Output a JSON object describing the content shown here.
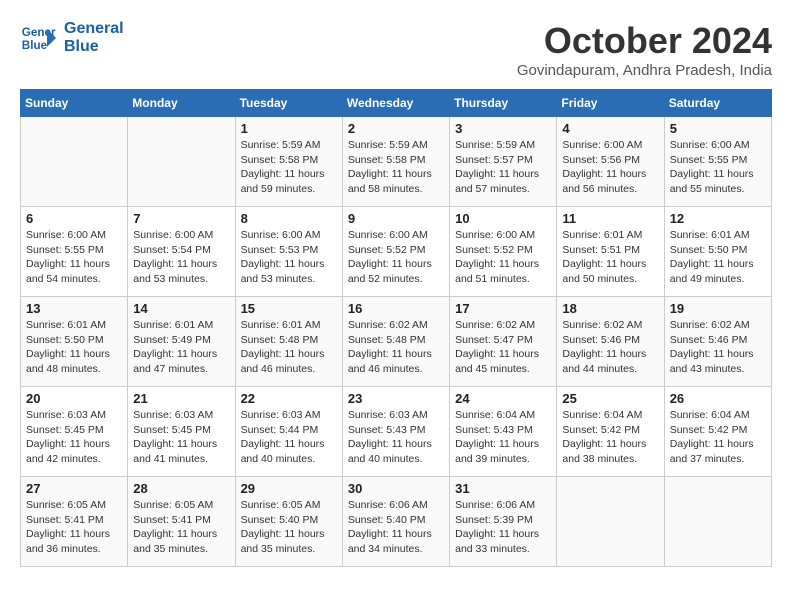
{
  "header": {
    "logo_line1": "General",
    "logo_line2": "Blue",
    "month": "October 2024",
    "location": "Govindapuram, Andhra Pradesh, India"
  },
  "days_of_week": [
    "Sunday",
    "Monday",
    "Tuesday",
    "Wednesday",
    "Thursday",
    "Friday",
    "Saturday"
  ],
  "weeks": [
    [
      {
        "day": "",
        "info": ""
      },
      {
        "day": "",
        "info": ""
      },
      {
        "day": "1",
        "info": "Sunrise: 5:59 AM\nSunset: 5:58 PM\nDaylight: 11 hours and 59 minutes."
      },
      {
        "day": "2",
        "info": "Sunrise: 5:59 AM\nSunset: 5:58 PM\nDaylight: 11 hours and 58 minutes."
      },
      {
        "day": "3",
        "info": "Sunrise: 5:59 AM\nSunset: 5:57 PM\nDaylight: 11 hours and 57 minutes."
      },
      {
        "day": "4",
        "info": "Sunrise: 6:00 AM\nSunset: 5:56 PM\nDaylight: 11 hours and 56 minutes."
      },
      {
        "day": "5",
        "info": "Sunrise: 6:00 AM\nSunset: 5:55 PM\nDaylight: 11 hours and 55 minutes."
      }
    ],
    [
      {
        "day": "6",
        "info": "Sunrise: 6:00 AM\nSunset: 5:55 PM\nDaylight: 11 hours and 54 minutes."
      },
      {
        "day": "7",
        "info": "Sunrise: 6:00 AM\nSunset: 5:54 PM\nDaylight: 11 hours and 53 minutes."
      },
      {
        "day": "8",
        "info": "Sunrise: 6:00 AM\nSunset: 5:53 PM\nDaylight: 11 hours and 53 minutes."
      },
      {
        "day": "9",
        "info": "Sunrise: 6:00 AM\nSunset: 5:52 PM\nDaylight: 11 hours and 52 minutes."
      },
      {
        "day": "10",
        "info": "Sunrise: 6:00 AM\nSunset: 5:52 PM\nDaylight: 11 hours and 51 minutes."
      },
      {
        "day": "11",
        "info": "Sunrise: 6:01 AM\nSunset: 5:51 PM\nDaylight: 11 hours and 50 minutes."
      },
      {
        "day": "12",
        "info": "Sunrise: 6:01 AM\nSunset: 5:50 PM\nDaylight: 11 hours and 49 minutes."
      }
    ],
    [
      {
        "day": "13",
        "info": "Sunrise: 6:01 AM\nSunset: 5:50 PM\nDaylight: 11 hours and 48 minutes."
      },
      {
        "day": "14",
        "info": "Sunrise: 6:01 AM\nSunset: 5:49 PM\nDaylight: 11 hours and 47 minutes."
      },
      {
        "day": "15",
        "info": "Sunrise: 6:01 AM\nSunset: 5:48 PM\nDaylight: 11 hours and 46 minutes."
      },
      {
        "day": "16",
        "info": "Sunrise: 6:02 AM\nSunset: 5:48 PM\nDaylight: 11 hours and 46 minutes."
      },
      {
        "day": "17",
        "info": "Sunrise: 6:02 AM\nSunset: 5:47 PM\nDaylight: 11 hours and 45 minutes."
      },
      {
        "day": "18",
        "info": "Sunrise: 6:02 AM\nSunset: 5:46 PM\nDaylight: 11 hours and 44 minutes."
      },
      {
        "day": "19",
        "info": "Sunrise: 6:02 AM\nSunset: 5:46 PM\nDaylight: 11 hours and 43 minutes."
      }
    ],
    [
      {
        "day": "20",
        "info": "Sunrise: 6:03 AM\nSunset: 5:45 PM\nDaylight: 11 hours and 42 minutes."
      },
      {
        "day": "21",
        "info": "Sunrise: 6:03 AM\nSunset: 5:45 PM\nDaylight: 11 hours and 41 minutes."
      },
      {
        "day": "22",
        "info": "Sunrise: 6:03 AM\nSunset: 5:44 PM\nDaylight: 11 hours and 40 minutes."
      },
      {
        "day": "23",
        "info": "Sunrise: 6:03 AM\nSunset: 5:43 PM\nDaylight: 11 hours and 40 minutes."
      },
      {
        "day": "24",
        "info": "Sunrise: 6:04 AM\nSunset: 5:43 PM\nDaylight: 11 hours and 39 minutes."
      },
      {
        "day": "25",
        "info": "Sunrise: 6:04 AM\nSunset: 5:42 PM\nDaylight: 11 hours and 38 minutes."
      },
      {
        "day": "26",
        "info": "Sunrise: 6:04 AM\nSunset: 5:42 PM\nDaylight: 11 hours and 37 minutes."
      }
    ],
    [
      {
        "day": "27",
        "info": "Sunrise: 6:05 AM\nSunset: 5:41 PM\nDaylight: 11 hours and 36 minutes."
      },
      {
        "day": "28",
        "info": "Sunrise: 6:05 AM\nSunset: 5:41 PM\nDaylight: 11 hours and 35 minutes."
      },
      {
        "day": "29",
        "info": "Sunrise: 6:05 AM\nSunset: 5:40 PM\nDaylight: 11 hours and 35 minutes."
      },
      {
        "day": "30",
        "info": "Sunrise: 6:06 AM\nSunset: 5:40 PM\nDaylight: 11 hours and 34 minutes."
      },
      {
        "day": "31",
        "info": "Sunrise: 6:06 AM\nSunset: 5:39 PM\nDaylight: 11 hours and 33 minutes."
      },
      {
        "day": "",
        "info": ""
      },
      {
        "day": "",
        "info": ""
      }
    ]
  ]
}
